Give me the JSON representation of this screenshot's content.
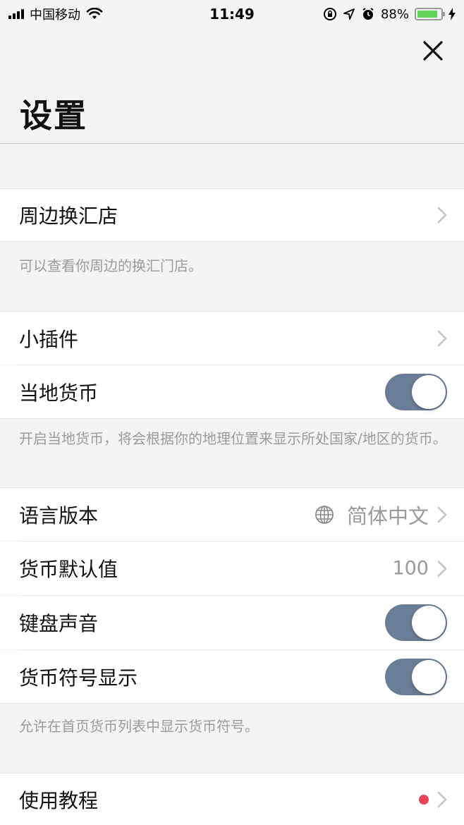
{
  "status_bar": {
    "carrier": "中国移动",
    "time": "11:49",
    "battery_percent": "88%",
    "battery_level": 0.88
  },
  "header": {
    "title": "设置"
  },
  "sections": {
    "nearby": {
      "label": "周边换汇店",
      "note": "可以查看你周边的换汇门店。"
    },
    "widget": {
      "label": "小插件"
    },
    "local_currency": {
      "label": "当地货币",
      "toggle_on": true,
      "note": "开启当地货币，将会根据你的地理位置来显示所处国家/地区的货币。"
    },
    "language": {
      "label": "语言版本",
      "value": "简体中文"
    },
    "default_value": {
      "label": "货币默认值",
      "value": "100"
    },
    "keyboard_sound": {
      "label": "键盘声音",
      "toggle_on": true
    },
    "currency_symbol": {
      "label": "货币符号显示",
      "toggle_on": true,
      "note": "允许在首页货币列表中显示货币符号。"
    },
    "tutorial": {
      "label": "使用教程"
    }
  },
  "colors": {
    "toggle_on": "#6a7d96",
    "badge_red": "#e8435a",
    "battery_green": "#5fd35a"
  }
}
